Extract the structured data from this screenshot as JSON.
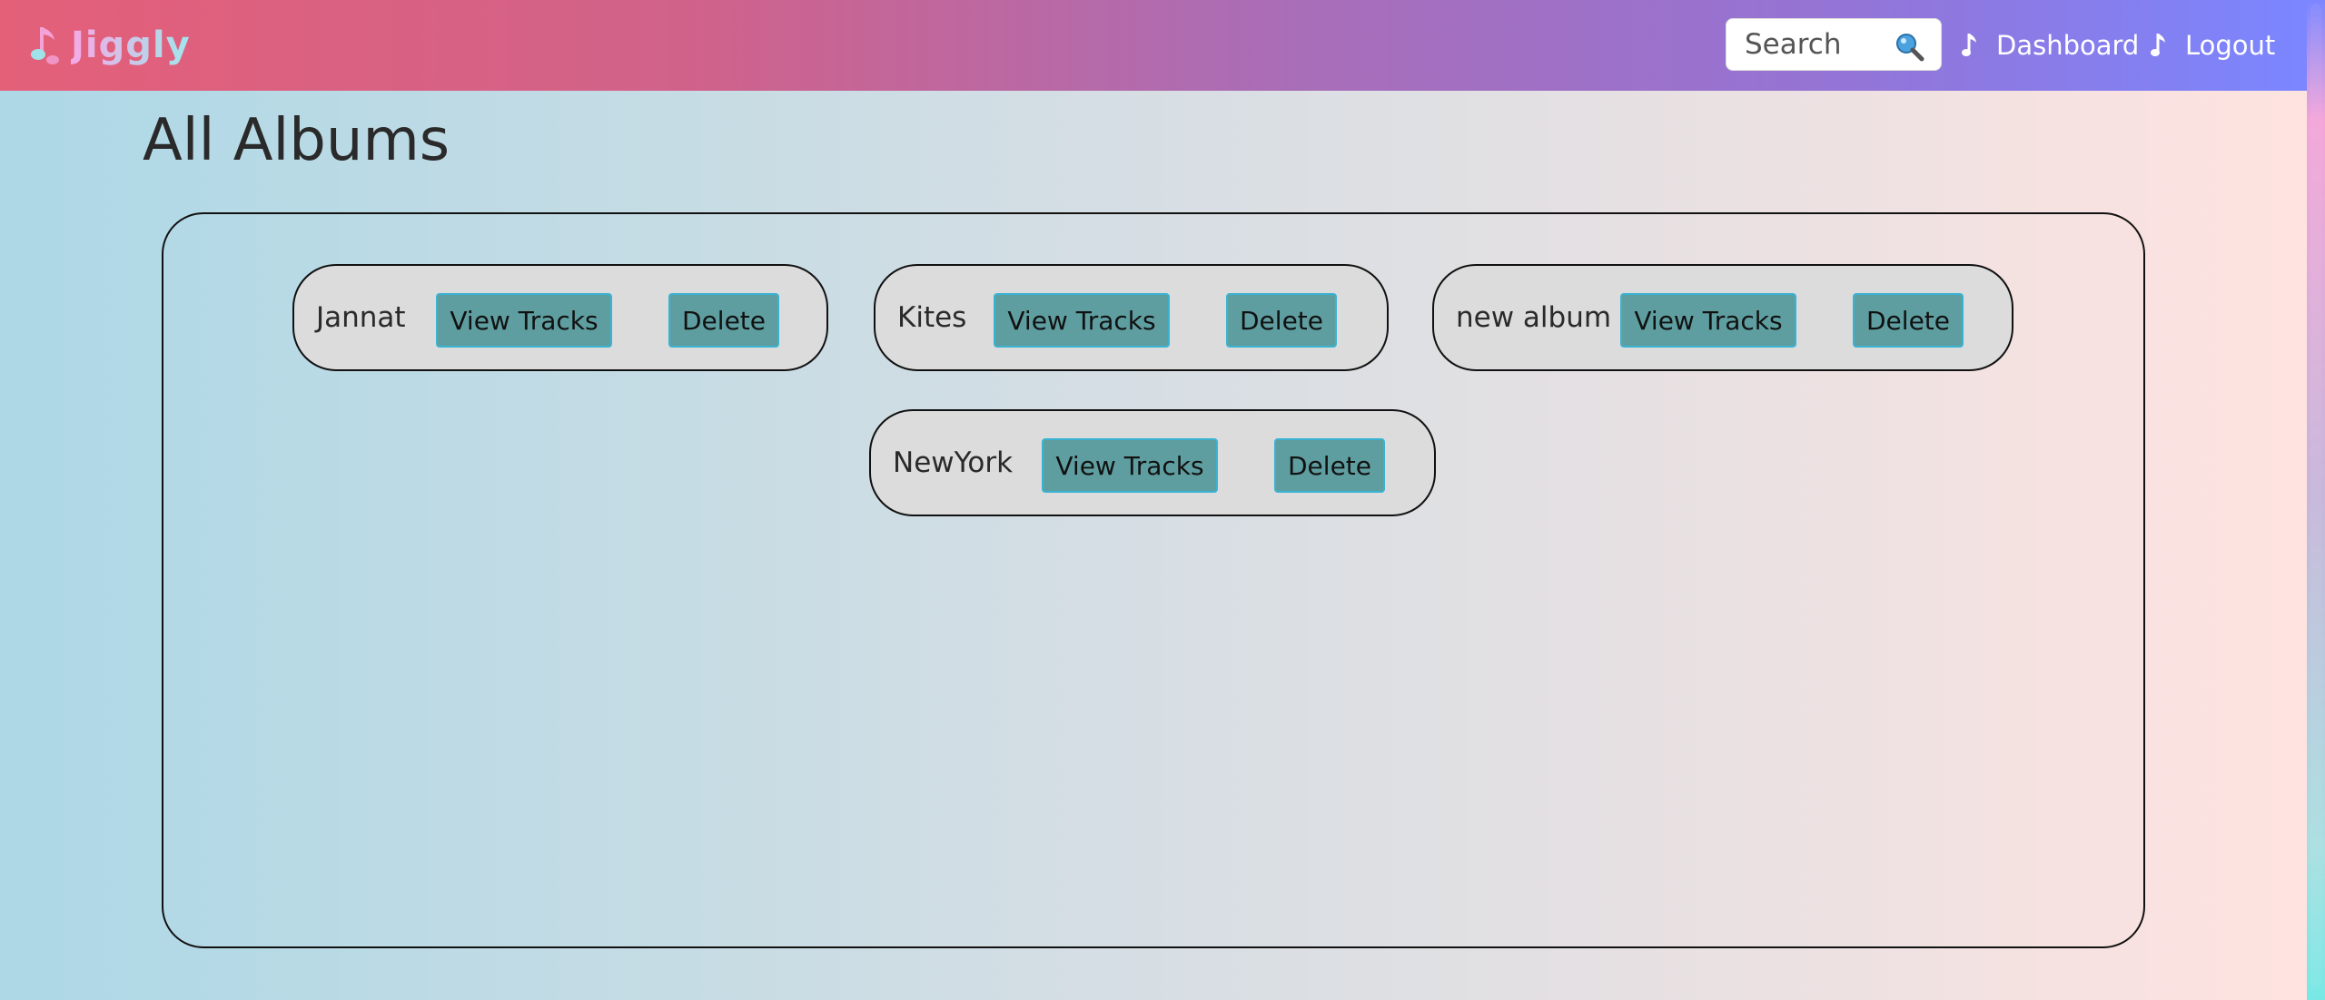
{
  "brand": {
    "name": "Jiggly"
  },
  "search": {
    "placeholder": "Search"
  },
  "nav": [
    {
      "label": "Dashboard"
    },
    {
      "label": "Logout"
    }
  ],
  "page": {
    "title": "All Albums"
  },
  "albums": [
    {
      "name": "Jannat",
      "view_label": "View Tracks",
      "delete_label": "Delete"
    },
    {
      "name": "Kites",
      "view_label": "View Tracks",
      "delete_label": "Delete"
    },
    {
      "name": "new album",
      "view_label": "View Tracks",
      "delete_label": "Delete"
    },
    {
      "name": "NewYork",
      "view_label": "View Tracks",
      "delete_label": "Delete"
    }
  ],
  "colors": {
    "button_bg": "#5f9ea0",
    "button_border": "#3ab3d3",
    "card_bg": "#dcdcdc",
    "nav_start": "#e46079",
    "nav_end": "#7b86ff"
  },
  "icons": {
    "brand": "music-note-icon",
    "search": "magnifier-icon",
    "nav": "music-note-icon"
  }
}
